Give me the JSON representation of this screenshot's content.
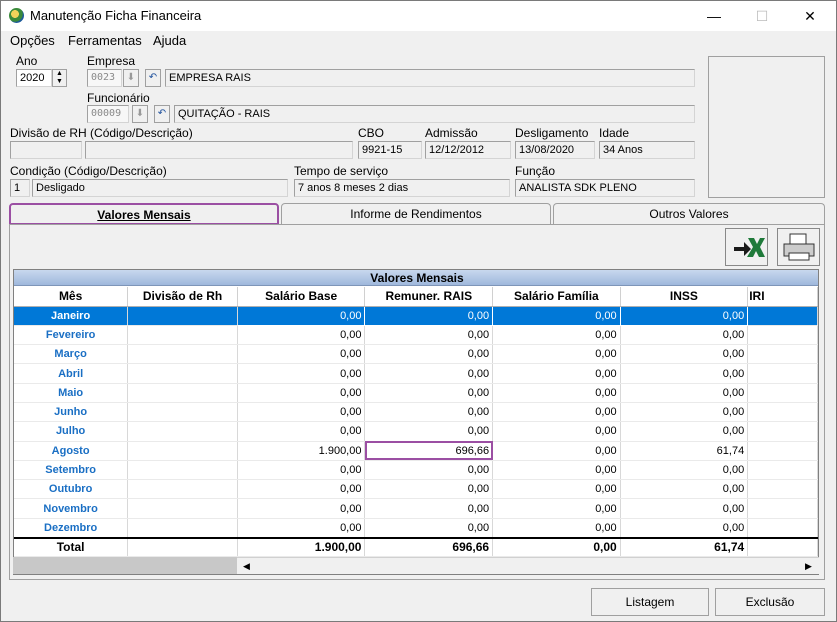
{
  "window": {
    "title": "Manutenção Ficha Financeira",
    "min": "—",
    "max": "☐",
    "close": "✕"
  },
  "menu": [
    "Opções",
    "Ferramentas",
    "Ajuda"
  ],
  "form": {
    "ano_label": "Ano",
    "ano_value": "2020",
    "empresa_label": "Empresa",
    "empresa_code": "0023",
    "empresa_name": "EMPRESA RAIS",
    "funcionario_label": "Funcionário",
    "funcionario_code": "00009",
    "funcionario_name": "QUITAÇÃO - RAIS",
    "divisao_label": "Divisão de RH (Código/Descrição)",
    "divisao_code": "",
    "divisao_desc": "",
    "cbo_label": "CBO",
    "cbo_value": "9921-15",
    "admissao_label": "Admissão",
    "admissao_value": "12/12/2012",
    "desligamento_label": "Desligamento",
    "desligamento_value": "13/08/2020",
    "idade_label": "Idade",
    "idade_value": "34 Anos",
    "condicao_label": "Condição (Código/Descrição)",
    "condicao_code": "1",
    "condicao_desc": "Desligado",
    "tempo_label": "Tempo de serviço",
    "tempo_value": "7 anos 8 meses 2 dias",
    "funcao_label": "Função",
    "funcao_value": "ANALISTA SDK PLENO"
  },
  "tabs": [
    "Valores Mensais",
    "Informe de Rendimentos",
    "Outros Valores"
  ],
  "grid": {
    "title": "Valores Mensais",
    "columns": [
      "Mês",
      "Divisão de Rh",
      "Salário Base",
      "Remuner. RAIS",
      "Salário Família",
      "INSS",
      "IRI"
    ],
    "rows": [
      [
        "Janeiro",
        "",
        "0,00",
        "0,00",
        "0,00",
        "0,00",
        ""
      ],
      [
        "Fevereiro",
        "",
        "0,00",
        "0,00",
        "0,00",
        "0,00",
        ""
      ],
      [
        "Março",
        "",
        "0,00",
        "0,00",
        "0,00",
        "0,00",
        ""
      ],
      [
        "Abril",
        "",
        "0,00",
        "0,00",
        "0,00",
        "0,00",
        ""
      ],
      [
        "Maio",
        "",
        "0,00",
        "0,00",
        "0,00",
        "0,00",
        ""
      ],
      [
        "Junho",
        "",
        "0,00",
        "0,00",
        "0,00",
        "0,00",
        ""
      ],
      [
        "Julho",
        "",
        "0,00",
        "0,00",
        "0,00",
        "0,00",
        ""
      ],
      [
        "Agosto",
        "",
        "1.900,00",
        "696,66",
        "0,00",
        "61,74",
        ""
      ],
      [
        "Setembro",
        "",
        "0,00",
        "0,00",
        "0,00",
        "0,00",
        ""
      ],
      [
        "Outubro",
        "",
        "0,00",
        "0,00",
        "0,00",
        "0,00",
        ""
      ],
      [
        "Novembro",
        "",
        "0,00",
        "0,00",
        "0,00",
        "0,00",
        ""
      ],
      [
        "Dezembro",
        "",
        "0,00",
        "0,00",
        "0,00",
        "0,00",
        ""
      ]
    ],
    "total": [
      "Total",
      "",
      "1.900,00",
      "696,66",
      "0,00",
      "61,74",
      ""
    ]
  },
  "buttons": {
    "listagem": "Listagem",
    "exclusao": "Exclusão"
  },
  "colors": {
    "selection": "#0078d7",
    "highlight": "#9b4fa3",
    "month_text": "#1a6fc4"
  }
}
